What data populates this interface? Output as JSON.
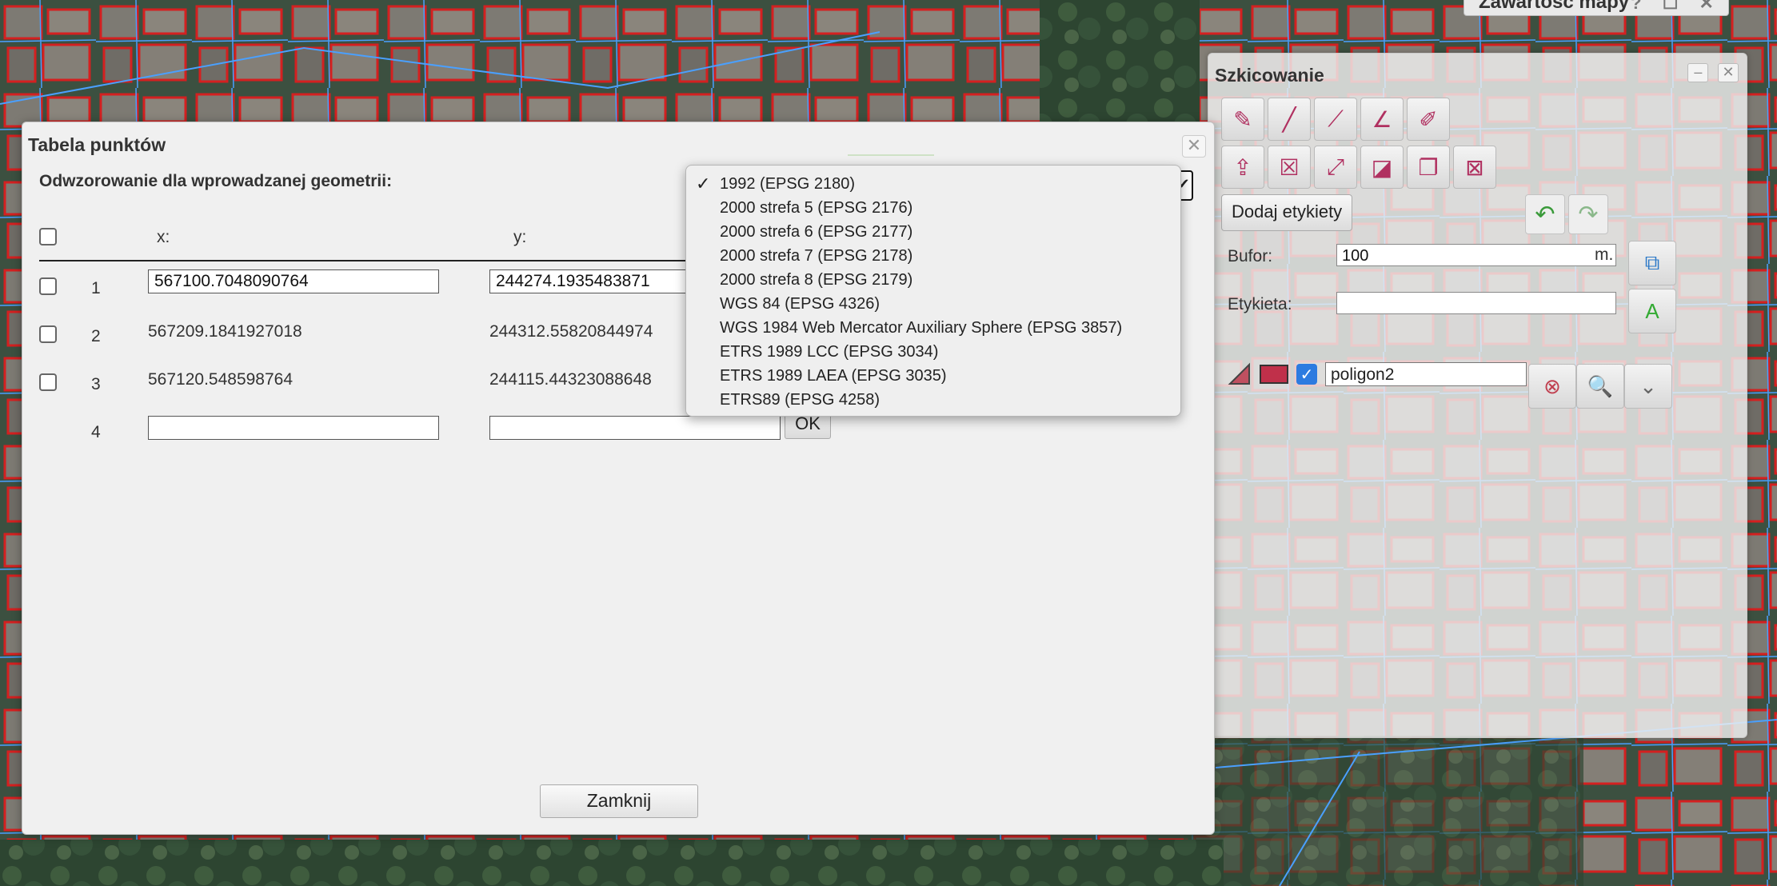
{
  "map_panel": {
    "title": "Zawartość mapy",
    "controls": "? ☐ ✕"
  },
  "sketch": {
    "title": "Szkicowanie",
    "minimize": "–",
    "close": "✕",
    "add_labels_button": "Dodaj etykiety",
    "buffer_label": "Bufor:",
    "buffer_value": "100",
    "buffer_unit": "m.",
    "label_label": "Etykieta:",
    "label_value": "",
    "layer_name": "poligon2",
    "layer_checked": "✓"
  },
  "dialog": {
    "title": "Tabela punktów",
    "close": "✕",
    "projection_label": "Odwzorowanie dla wprowadzanej geometrii:",
    "col_x": "x:",
    "col_y": "y:",
    "rows": [
      {
        "num": "1",
        "x": "567100.7048090764",
        "y": "244274.1935483871"
      },
      {
        "num": "2",
        "x": "567209.1841927018",
        "y": "244312.55820844974"
      },
      {
        "num": "3",
        "x": "567120.548598764",
        "y": "244115.44323088648"
      },
      {
        "num": "4",
        "x": "",
        "y": ""
      }
    ],
    "ok_button": "OK",
    "close_button": "Zamknij"
  },
  "projection_dropdown": {
    "selected_index": 0,
    "check_mark": "✓",
    "options": [
      "1992 (EPSG 2180)",
      "2000 strefa 5 (EPSG 2176)",
      "2000 strefa 6 (EPSG 2177)",
      "2000 strefa 7 (EPSG 2178)",
      "2000 strefa 8 (EPSG 2179)",
      "WGS 84 (EPSG 4326)",
      "WGS 1984 Web Mercator Auxiliary Sphere (EPSG 3857)",
      "ETRS 1989 LCC (EPSG 3034)",
      "ETRS 1989 LAEA (EPSG 3035)",
      "ETRS89 (EPSG 4258)"
    ]
  },
  "colors": {
    "building_outline": "#d42020",
    "parcel_line": "#4aa0ff",
    "map_base": "#2e4330"
  }
}
